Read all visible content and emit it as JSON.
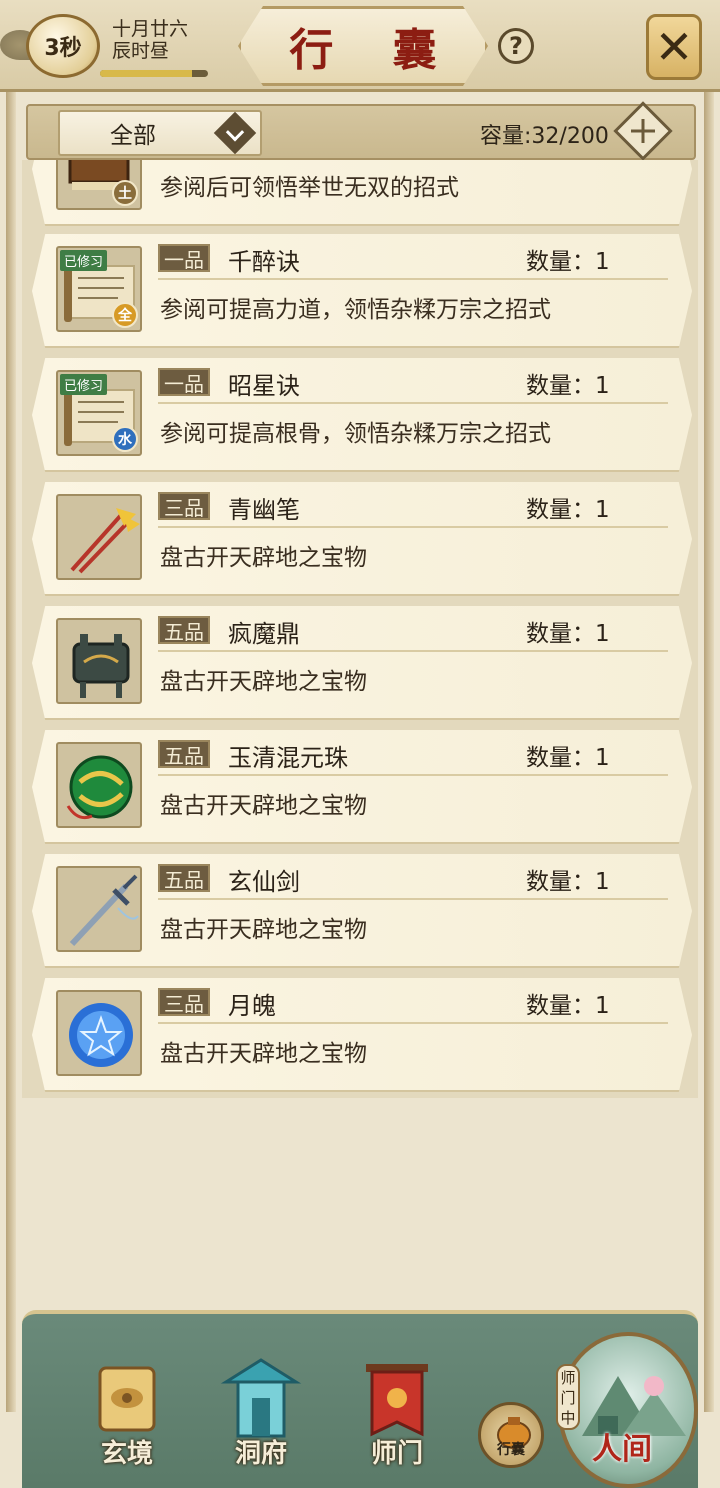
{
  "header": {
    "timer": "3秒",
    "date_line1": "十月廿六",
    "date_line2": "辰时昼",
    "time_progress": 0.85,
    "title": "行 囊",
    "help_label": "?",
    "close_label": "✕"
  },
  "filter": {
    "category": "全部",
    "capacity": "容量:32/200"
  },
  "items": [
    {
      "grade": "",
      "name": "",
      "qty": "",
      "desc": "参阅后可领悟举世无双的招式",
      "learned": "",
      "element": "土",
      "element_color": "#8a6d3b",
      "icon": "book-icon"
    },
    {
      "grade": "一品",
      "name": "千醉诀",
      "qty": "数量：1",
      "desc": "参阅可提高力道，领悟杂糅万宗之招式",
      "learned": "已修习",
      "element": "全",
      "element_color": "#d79a25",
      "icon": "scroll-icon"
    },
    {
      "grade": "一品",
      "name": "昭星诀",
      "qty": "数量：1",
      "desc": "参阅可提高根骨，领悟杂糅万宗之招式",
      "learned": "已修习",
      "element": "水",
      "element_color": "#2f6fbd",
      "icon": "scroll-icon"
    },
    {
      "grade": "三品",
      "name": "青幽笔",
      "qty": "数量：1",
      "desc": "盘古开天辟地之宝物",
      "learned": "",
      "element": "",
      "element_color": "",
      "icon": "brush-icon"
    },
    {
      "grade": "五品",
      "name": "疯魔鼎",
      "qty": "数量：1",
      "desc": "盘古开天辟地之宝物",
      "learned": "",
      "element": "",
      "element_color": "",
      "icon": "cauldron-icon"
    },
    {
      "grade": "五品",
      "name": "玉清混元珠",
      "qty": "数量：1",
      "desc": "盘古开天辟地之宝物",
      "learned": "",
      "element": "",
      "element_color": "",
      "icon": "orb-icon"
    },
    {
      "grade": "五品",
      "name": "玄仙剑",
      "qty": "数量：1",
      "desc": "盘古开天辟地之宝物",
      "learned": "",
      "element": "",
      "element_color": "",
      "icon": "sword-icon"
    },
    {
      "grade": "三品",
      "name": "月魄",
      "qty": "数量：1",
      "desc": "盘古开天辟地之宝物",
      "learned": "",
      "element": "",
      "element_color": "",
      "icon": "moon-orb-icon"
    }
  ],
  "nav": {
    "xuanjing": "玄境",
    "dongfu": "洞府",
    "shimen": "师门",
    "bag": "行囊",
    "sect_status": "师门中",
    "realm": "人间"
  },
  "colors": {
    "title_red": "#8c1d12",
    "nav_green": "#5a7a68"
  }
}
